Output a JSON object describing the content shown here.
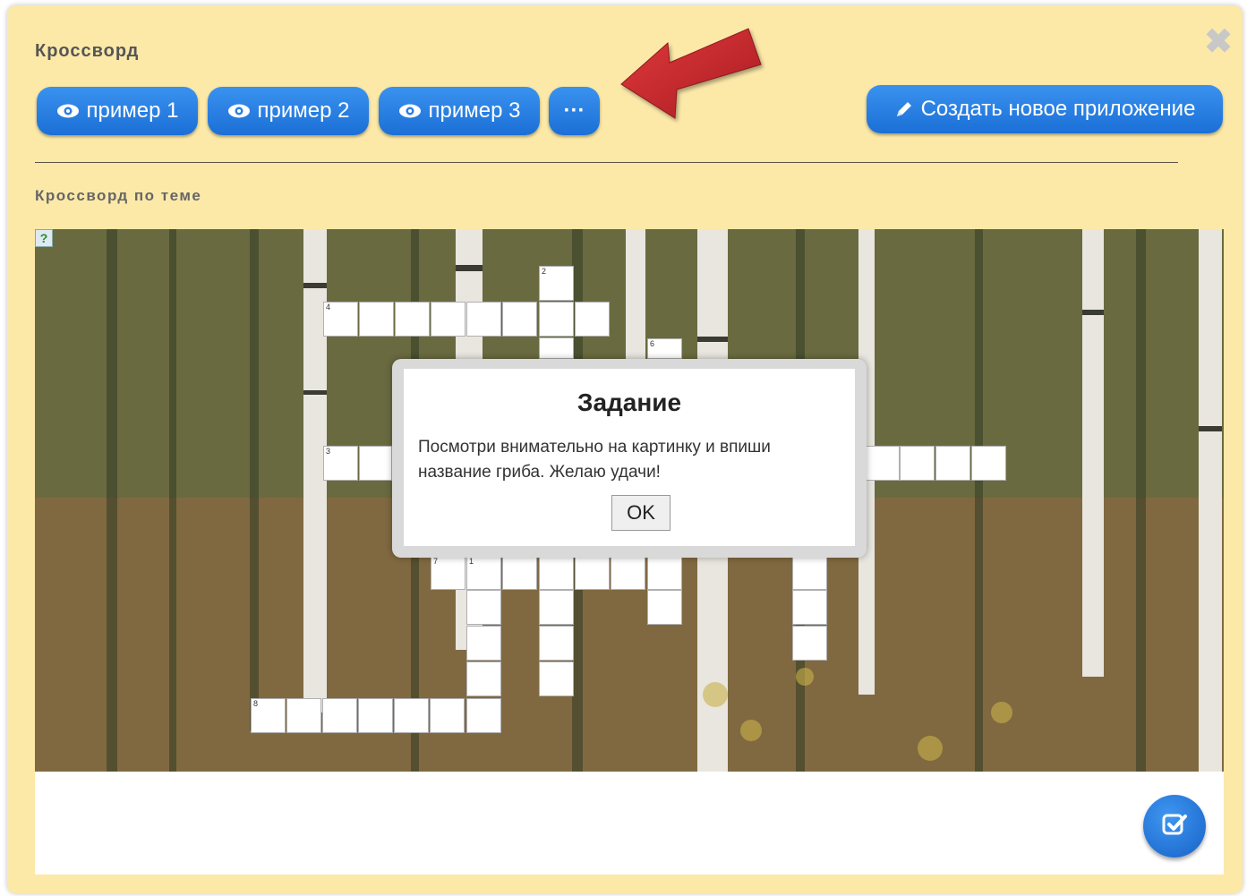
{
  "app": {
    "title": "Кроссворд",
    "subtitle": "Кроссворд по теме"
  },
  "toolbar": {
    "example1_label": "пример 1",
    "example2_label": "пример 2",
    "example3_label": "пример 3",
    "more_label": "···",
    "create_label": "Создать новое приложение"
  },
  "icons": {
    "close": "close-icon",
    "eye": "eye-icon",
    "pencil": "pencil-icon",
    "check": "check-square-icon",
    "help": "help-icon"
  },
  "crossword": {
    "help_label": "?",
    "numbers": [
      "2",
      "4",
      "6",
      "3",
      "7",
      "1",
      "8"
    ]
  },
  "modal": {
    "title": "Задание",
    "text": "Посмотри внимательно на картинку и впиши название гриба. Желаю удачи!",
    "ok_label": "OK"
  },
  "colors": {
    "panel_bg": "#fce9a8",
    "button_blue": "#1b6fd6",
    "arrow_red": "#c8262a"
  }
}
